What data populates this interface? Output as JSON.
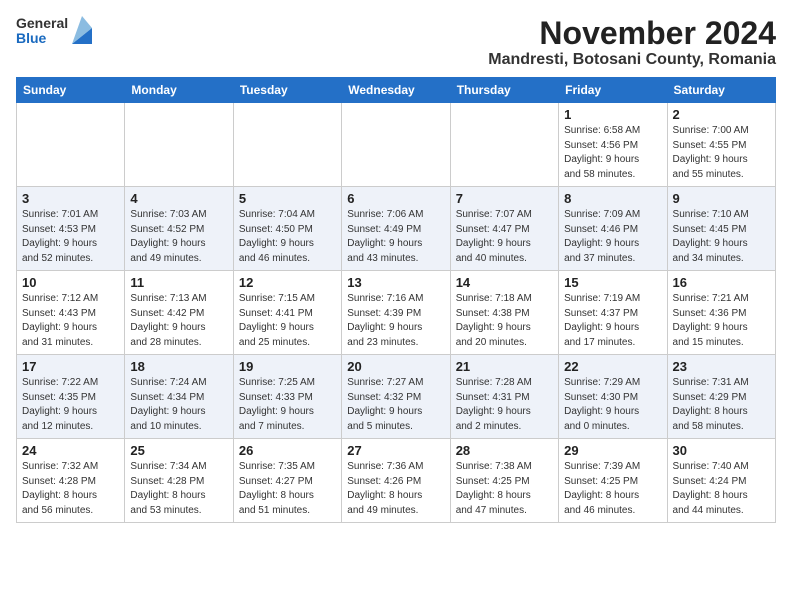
{
  "header": {
    "logo_general": "General",
    "logo_blue": "Blue",
    "title": "November 2024",
    "subtitle": "Mandresti, Botosani County, Romania"
  },
  "weekdays": [
    "Sunday",
    "Monday",
    "Tuesday",
    "Wednesday",
    "Thursday",
    "Friday",
    "Saturday"
  ],
  "weeks": [
    [
      {
        "day": "",
        "info": ""
      },
      {
        "day": "",
        "info": ""
      },
      {
        "day": "",
        "info": ""
      },
      {
        "day": "",
        "info": ""
      },
      {
        "day": "",
        "info": ""
      },
      {
        "day": "1",
        "info": "Sunrise: 6:58 AM\nSunset: 4:56 PM\nDaylight: 9 hours\nand 58 minutes."
      },
      {
        "day": "2",
        "info": "Sunrise: 7:00 AM\nSunset: 4:55 PM\nDaylight: 9 hours\nand 55 minutes."
      }
    ],
    [
      {
        "day": "3",
        "info": "Sunrise: 7:01 AM\nSunset: 4:53 PM\nDaylight: 9 hours\nand 52 minutes."
      },
      {
        "day": "4",
        "info": "Sunrise: 7:03 AM\nSunset: 4:52 PM\nDaylight: 9 hours\nand 49 minutes."
      },
      {
        "day": "5",
        "info": "Sunrise: 7:04 AM\nSunset: 4:50 PM\nDaylight: 9 hours\nand 46 minutes."
      },
      {
        "day": "6",
        "info": "Sunrise: 7:06 AM\nSunset: 4:49 PM\nDaylight: 9 hours\nand 43 minutes."
      },
      {
        "day": "7",
        "info": "Sunrise: 7:07 AM\nSunset: 4:47 PM\nDaylight: 9 hours\nand 40 minutes."
      },
      {
        "day": "8",
        "info": "Sunrise: 7:09 AM\nSunset: 4:46 PM\nDaylight: 9 hours\nand 37 minutes."
      },
      {
        "day": "9",
        "info": "Sunrise: 7:10 AM\nSunset: 4:45 PM\nDaylight: 9 hours\nand 34 minutes."
      }
    ],
    [
      {
        "day": "10",
        "info": "Sunrise: 7:12 AM\nSunset: 4:43 PM\nDaylight: 9 hours\nand 31 minutes."
      },
      {
        "day": "11",
        "info": "Sunrise: 7:13 AM\nSunset: 4:42 PM\nDaylight: 9 hours\nand 28 minutes."
      },
      {
        "day": "12",
        "info": "Sunrise: 7:15 AM\nSunset: 4:41 PM\nDaylight: 9 hours\nand 25 minutes."
      },
      {
        "day": "13",
        "info": "Sunrise: 7:16 AM\nSunset: 4:39 PM\nDaylight: 9 hours\nand 23 minutes."
      },
      {
        "day": "14",
        "info": "Sunrise: 7:18 AM\nSunset: 4:38 PM\nDaylight: 9 hours\nand 20 minutes."
      },
      {
        "day": "15",
        "info": "Sunrise: 7:19 AM\nSunset: 4:37 PM\nDaylight: 9 hours\nand 17 minutes."
      },
      {
        "day": "16",
        "info": "Sunrise: 7:21 AM\nSunset: 4:36 PM\nDaylight: 9 hours\nand 15 minutes."
      }
    ],
    [
      {
        "day": "17",
        "info": "Sunrise: 7:22 AM\nSunset: 4:35 PM\nDaylight: 9 hours\nand 12 minutes."
      },
      {
        "day": "18",
        "info": "Sunrise: 7:24 AM\nSunset: 4:34 PM\nDaylight: 9 hours\nand 10 minutes."
      },
      {
        "day": "19",
        "info": "Sunrise: 7:25 AM\nSunset: 4:33 PM\nDaylight: 9 hours\nand 7 minutes."
      },
      {
        "day": "20",
        "info": "Sunrise: 7:27 AM\nSunset: 4:32 PM\nDaylight: 9 hours\nand 5 minutes."
      },
      {
        "day": "21",
        "info": "Sunrise: 7:28 AM\nSunset: 4:31 PM\nDaylight: 9 hours\nand 2 minutes."
      },
      {
        "day": "22",
        "info": "Sunrise: 7:29 AM\nSunset: 4:30 PM\nDaylight: 9 hours\nand 0 minutes."
      },
      {
        "day": "23",
        "info": "Sunrise: 7:31 AM\nSunset: 4:29 PM\nDaylight: 8 hours\nand 58 minutes."
      }
    ],
    [
      {
        "day": "24",
        "info": "Sunrise: 7:32 AM\nSunset: 4:28 PM\nDaylight: 8 hours\nand 56 minutes."
      },
      {
        "day": "25",
        "info": "Sunrise: 7:34 AM\nSunset: 4:28 PM\nDaylight: 8 hours\nand 53 minutes."
      },
      {
        "day": "26",
        "info": "Sunrise: 7:35 AM\nSunset: 4:27 PM\nDaylight: 8 hours\nand 51 minutes."
      },
      {
        "day": "27",
        "info": "Sunrise: 7:36 AM\nSunset: 4:26 PM\nDaylight: 8 hours\nand 49 minutes."
      },
      {
        "day": "28",
        "info": "Sunrise: 7:38 AM\nSunset: 4:25 PM\nDaylight: 8 hours\nand 47 minutes."
      },
      {
        "day": "29",
        "info": "Sunrise: 7:39 AM\nSunset: 4:25 PM\nDaylight: 8 hours\nand 46 minutes."
      },
      {
        "day": "30",
        "info": "Sunrise: 7:40 AM\nSunset: 4:24 PM\nDaylight: 8 hours\nand 44 minutes."
      }
    ]
  ]
}
